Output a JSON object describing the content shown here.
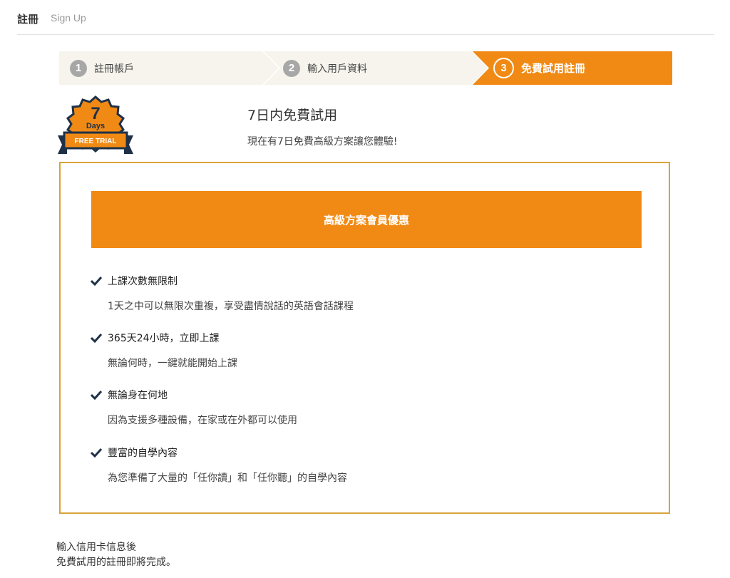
{
  "header": {
    "title": "註冊",
    "subtitle": "Sign Up"
  },
  "steps": [
    {
      "num": "1",
      "label": "註冊帳戶",
      "state": "done"
    },
    {
      "num": "2",
      "label": "輸入用戶資料",
      "state": "done"
    },
    {
      "num": "3",
      "label": "免費試用註冊",
      "state": "active"
    }
  ],
  "badge": {
    "number": "7",
    "days": "Days",
    "ribbon": "FREE TRIAL"
  },
  "intro": {
    "title": "7日内免費試用",
    "subtitle": "現在有7日免費高級方案讓您體驗!"
  },
  "plan": {
    "banner": "高級方案會員優惠",
    "features": [
      {
        "title": "上課次數無限制",
        "desc": "1天之中可以無限次重複，享受盡情說話的英語會話課程"
      },
      {
        "title": "365天24小時，立即上課",
        "desc": "無論何時，一鍵就能開始上課"
      },
      {
        "title": "無論身在何地",
        "desc": "因為支援多種設備，在家或在外都可以使用"
      },
      {
        "title": "豐富的自學內容",
        "desc": "為您準備了大量的「任你讀」和「任你聽」的自學內容"
      }
    ]
  },
  "footer": {
    "line1": "輸入信用卡信息後",
    "line2": "免費試用的註冊即將完成。"
  },
  "colors": {
    "accent": "#f08a14",
    "step_bg": "#f6f4ec",
    "box_border": "#d9a33b",
    "badge_dark": "#1f3148"
  }
}
